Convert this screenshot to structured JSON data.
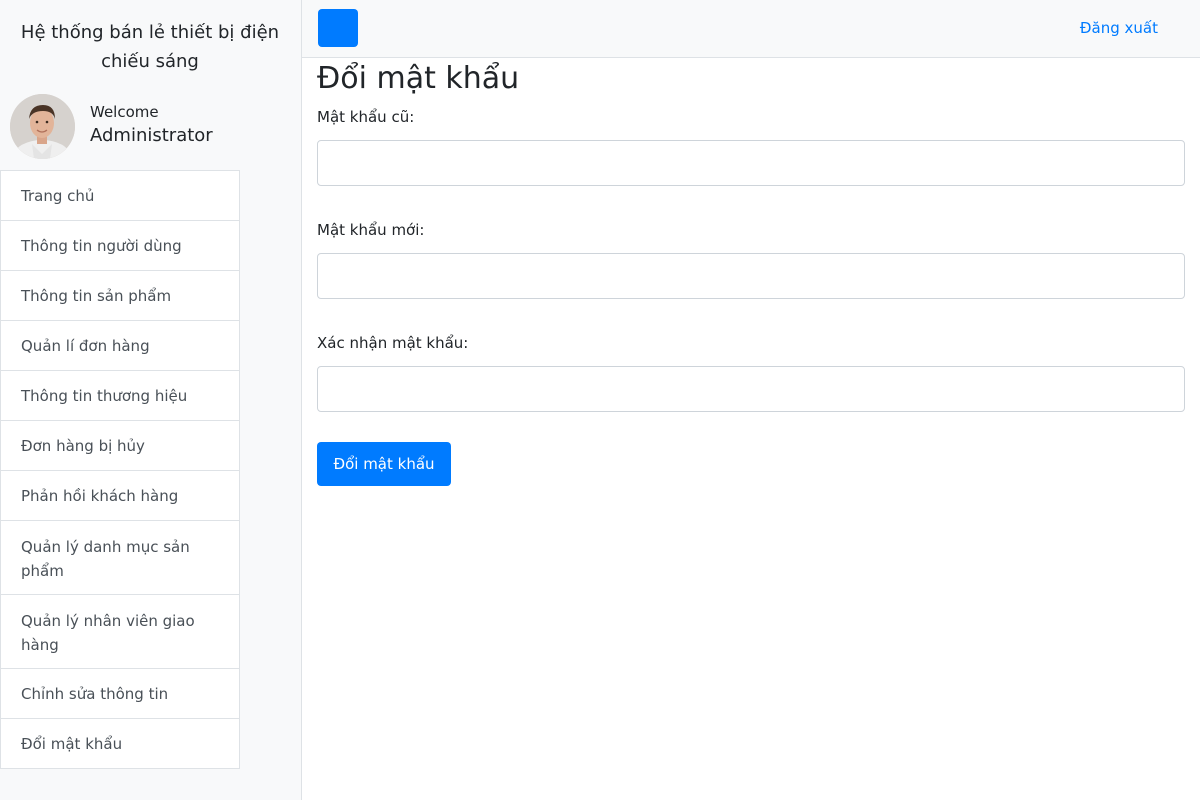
{
  "sidebar": {
    "brand_line1": "Hệ thống bán lẻ thiết bị điện",
    "brand_line2": "chiếu sáng",
    "welcome": "Welcome",
    "username": "Administrator",
    "menu": [
      {
        "line1": "Trang chủ",
        "line2": ""
      },
      {
        "line1": "Thông tin người dùng",
        "line2": ""
      },
      {
        "line1": "Thông tin sản phẩm",
        "line2": ""
      },
      {
        "line1": "Quản lí đơn hàng",
        "line2": ""
      },
      {
        "line1": "Thông tin thương hiệu",
        "line2": ""
      },
      {
        "line1": "Đơn hàng bị hủy",
        "line2": ""
      },
      {
        "line1": "Phản hồi khách hàng",
        "line2": ""
      },
      {
        "line1": "Quản lý danh mục sản",
        "line2": "phẩm"
      },
      {
        "line1": "Quản lý nhân viên giao",
        "line2": "hàng"
      },
      {
        "line1": "Chỉnh sửa thông tin",
        "line2": ""
      },
      {
        "line1": "Đổi mật khẩu",
        "line2": ""
      }
    ]
  },
  "topbar": {
    "logout_label": "Đăng xuất"
  },
  "form": {
    "title": "Đổi mật khẩu",
    "old_password_label": "Mật khẩu cũ:",
    "old_password_value": "",
    "new_password_label": "Mật khẩu mới:",
    "new_password_value": "",
    "confirm_password_label": "Xác nhận mật khẩu:",
    "confirm_password_value": "",
    "submit_label": "Đổi mật khẩu"
  },
  "colors": {
    "primary": "#007bff",
    "sidebar_bg": "#f8f9fa",
    "border": "#dee2e6"
  }
}
